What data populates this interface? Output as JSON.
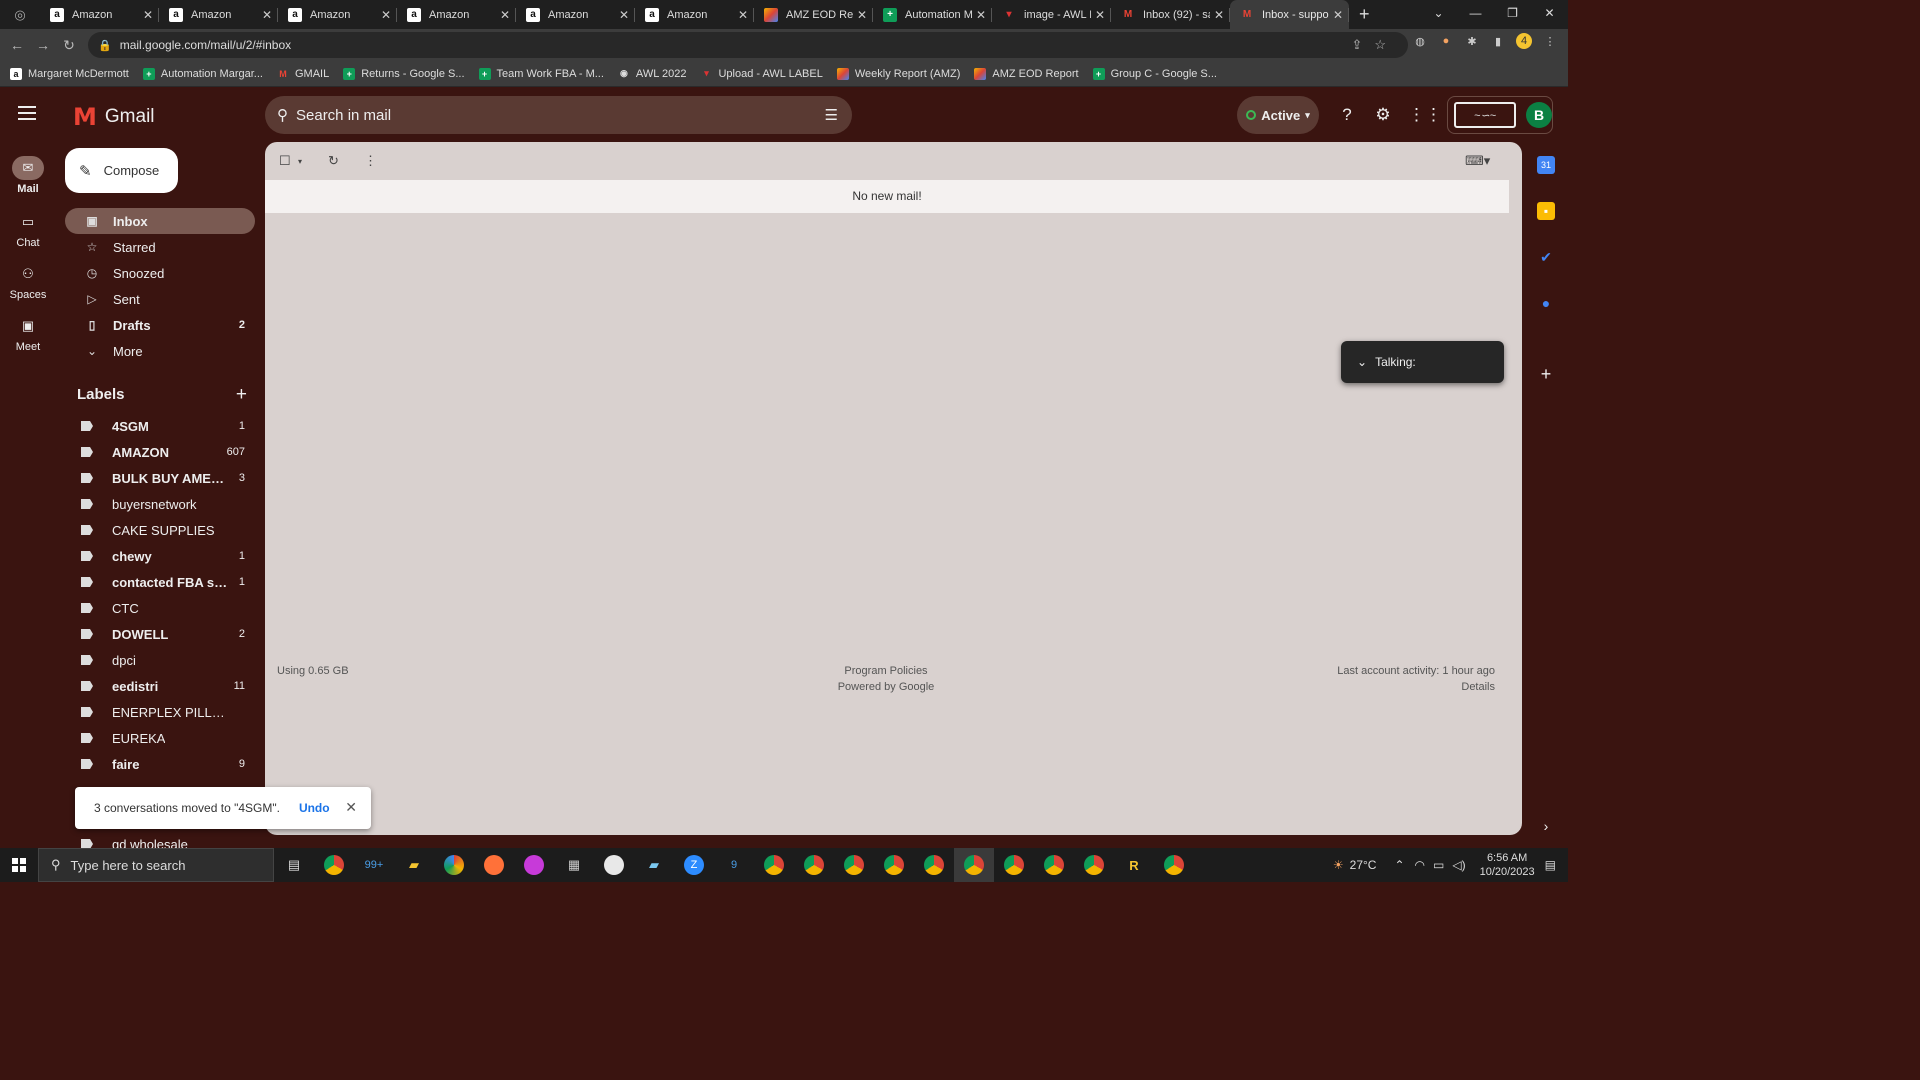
{
  "browser": {
    "tabs": [
      {
        "title": "Amazon",
        "favicon": "amazon"
      },
      {
        "title": "Amazon",
        "favicon": "amazon"
      },
      {
        "title": "Amazon",
        "favicon": "amazon"
      },
      {
        "title": "Amazon",
        "favicon": "amazon"
      },
      {
        "title": "Amazon",
        "favicon": "amazon"
      },
      {
        "title": "Amazon",
        "favicon": "amazon"
      },
      {
        "title": "AMZ EOD Rep",
        "favicon": "multicolor"
      },
      {
        "title": "Automation M",
        "favicon": "sheets"
      },
      {
        "title": "image - AWL L",
        "favicon": "redline"
      },
      {
        "title": "Inbox (92) - sa",
        "favicon": "gmail"
      },
      {
        "title": "Inbox - suppo",
        "favicon": "gmail",
        "active": true
      }
    ],
    "url": "mail.google.com/mail/u/2/#inbox",
    "bookmarks": [
      {
        "label": "Margaret McDermott",
        "favicon": "amazon"
      },
      {
        "label": "Automation Margar...",
        "favicon": "sheets"
      },
      {
        "label": "GMAIL",
        "favicon": "gmail"
      },
      {
        "label": "Returns - Google S...",
        "favicon": "sheets"
      },
      {
        "label": "Team Work FBA - M...",
        "favicon": "sheets"
      },
      {
        "label": "AWL 2022",
        "favicon": "globe"
      },
      {
        "label": "Upload - AWL LABEL",
        "favicon": "redline"
      },
      {
        "label": "Weekly Report (AMZ)",
        "favicon": "multicolor"
      },
      {
        "label": "AMZ EOD Report",
        "favicon": "multicolor"
      },
      {
        "label": "Group C - Google S...",
        "favicon": "sheets"
      }
    ]
  },
  "gmail": {
    "brand": "Gmail",
    "search_placeholder": "Search in mail",
    "status": "Active",
    "avatar_letter": "B",
    "rail": [
      {
        "label": "Mail",
        "icon": "mail-icon",
        "selected": true
      },
      {
        "label": "Chat",
        "icon": "chat-icon"
      },
      {
        "label": "Spaces",
        "icon": "spaces-icon"
      },
      {
        "label": "Meet",
        "icon": "meet-icon"
      }
    ],
    "compose_label": "Compose",
    "nav": [
      {
        "label": "Inbox",
        "icon": "inbox-icon",
        "count": "",
        "selected": true
      },
      {
        "label": "Starred",
        "icon": "star-icon",
        "count": ""
      },
      {
        "label": "Snoozed",
        "icon": "clock-icon",
        "count": ""
      },
      {
        "label": "Sent",
        "icon": "send-icon",
        "count": ""
      },
      {
        "label": "Drafts",
        "icon": "draft-icon",
        "count": "2",
        "bold": true
      },
      {
        "label": "More",
        "icon": "chevron-down-icon",
        "count": ""
      }
    ],
    "labels_heading": "Labels",
    "labels": [
      {
        "name": "4SGM",
        "count": "1",
        "bold": true
      },
      {
        "name": "AMAZON",
        "count": "607",
        "bold": true
      },
      {
        "name": "BULK BUY AMERICA",
        "count": "3",
        "bold": true
      },
      {
        "name": "buyersnetwork",
        "count": ""
      },
      {
        "name": "CAKE SUPPLIES",
        "count": ""
      },
      {
        "name": "chewy",
        "count": "1",
        "bold": true
      },
      {
        "name": "contacted FBA sup...",
        "count": "1",
        "bold": true
      },
      {
        "name": "CTC",
        "count": ""
      },
      {
        "name": "DOWELL",
        "count": "2",
        "bold": true
      },
      {
        "name": "dpci",
        "count": ""
      },
      {
        "name": "eedistri",
        "count": "11",
        "bold": true
      },
      {
        "name": "ENERPLEX PILLOW",
        "count": ""
      },
      {
        "name": "EUREKA",
        "count": ""
      },
      {
        "name": "faire",
        "count": "9",
        "bold": true
      },
      {
        "name": "gd wholesale",
        "count": ""
      }
    ],
    "empty_message": "No new mail!",
    "footer": {
      "storage": "Using 0.65 GB",
      "policies": "Program Policies",
      "powered": "Powered by Google",
      "activity": "Last account activity: 1 hour ago",
      "details": "Details"
    },
    "talking_label": "Talking:",
    "snackbar": {
      "message": "3 conversations moved to \"4SGM\".",
      "action": "Undo"
    }
  },
  "taskbar": {
    "search_placeholder": "Type here to search",
    "weather": "27°C",
    "time": "6:56 AM",
    "date": "10/20/2023",
    "badges": {
      "mail": "99+",
      "app": "9"
    }
  }
}
